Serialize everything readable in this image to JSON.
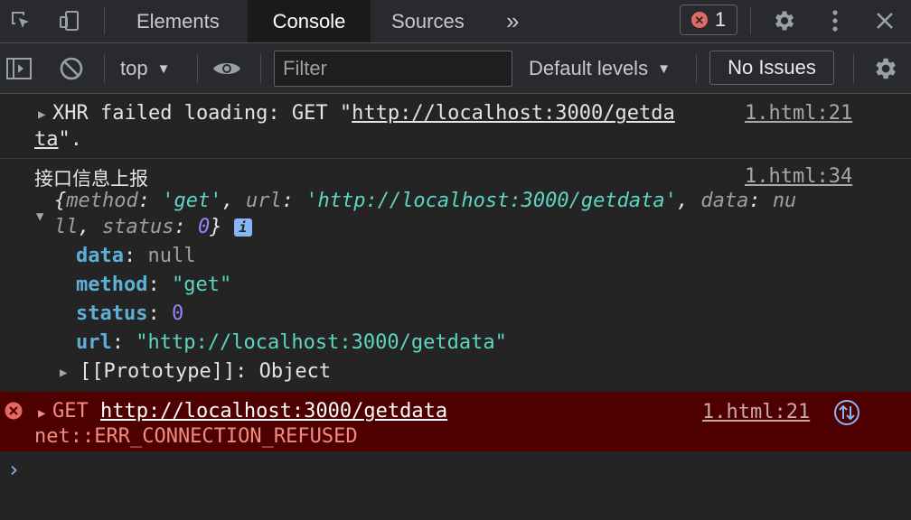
{
  "tabs": [
    "Elements",
    "Console",
    "Sources"
  ],
  "more_tabs": "»",
  "error_count": "1",
  "toolbar": {
    "context": "top",
    "filter_placeholder": "Filter",
    "levels": "Default levels",
    "issues": "No Issues"
  },
  "messages": {
    "xhr": {
      "line1_prefix": "XHR failed loading: GET \"",
      "url_part1": "http://localhost:3000/getda",
      "url_part2": "ta",
      "line2_suffix": "\".",
      "source": "1.html:21"
    },
    "log": {
      "label": "接口信息上报",
      "source": "1.html:34",
      "preview_line1": "{method: 'get', url: 'http://localhost:3000/getdata', data: nu",
      "preview_line2": "ll, status: 0}",
      "props": [
        {
          "key": "data",
          "value": "null"
        },
        {
          "key": "method",
          "value": "\"get\""
        },
        {
          "key": "status",
          "value": "0"
        },
        {
          "key": "url",
          "value": "\"http://localhost:3000/getdata\""
        }
      ],
      "prototype": "[[Prototype]]: Object"
    },
    "error": {
      "method": "GET ",
      "url": "http://localhost:3000/getdata",
      "detail": "net::ERR_CONNECTION_REFUSED",
      "source": "1.html:21"
    }
  },
  "prompt": "›"
}
